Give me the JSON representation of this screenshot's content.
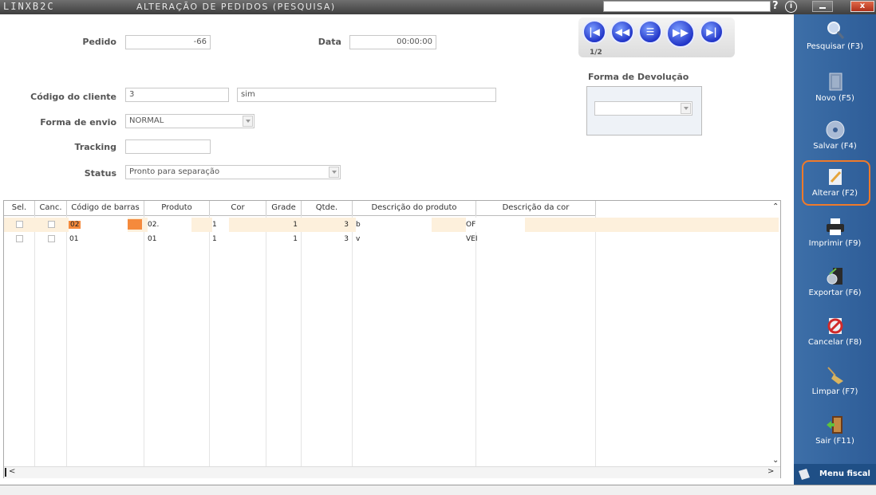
{
  "titlebar": {
    "app_name": "LINXB2C",
    "window_title": "ALTERAÇÃO DE PEDIDOS (PESQUISA)",
    "help": "?",
    "info": "i",
    "close": "x"
  },
  "form": {
    "pedido_label": "Pedido",
    "pedido_value": "-66",
    "data_label": "Data",
    "data_value": "00:00:00",
    "codigo_cliente_label": "Código do cliente",
    "codigo_cliente_value": "3",
    "cliente_nome_value": "sim",
    "forma_envio_label": "Forma de envio",
    "forma_envio_value": "NORMAL",
    "tracking_label": "Tracking",
    "tracking_value": "",
    "status_label": "Status",
    "status_value": "Pronto para separação",
    "forma_devolucao_label": "Forma de Devolução",
    "forma_devolucao_value": ""
  },
  "navigation": {
    "pager": "1/2"
  },
  "grid": {
    "columns": [
      "Sel.",
      "Canc.",
      "Código de barras",
      "Produto",
      "Cor",
      "Grade",
      "Qtde.",
      "Descrição do produto",
      "Descrição da cor"
    ],
    "rows": [
      {
        "barcode": "02",
        "produto": "02.",
        "cor": "1",
        "grade": "1",
        "qtde": "3",
        "descricao": "b",
        "desc_cor": "OF"
      },
      {
        "barcode": "01",
        "produto": "01",
        "cor": "1",
        "grade": "1",
        "qtde": "3",
        "descricao": "v",
        "desc_cor": "VEI"
      }
    ]
  },
  "sidebar": {
    "items": [
      {
        "label": "Pesquisar (F3)",
        "icon": "magnifier-icon"
      },
      {
        "label": "Novo (F5)",
        "icon": "new-document-icon"
      },
      {
        "label": "Salvar (F4)",
        "icon": "disc-icon"
      },
      {
        "label": "Alterar (F2)",
        "icon": "edit-pencil-icon"
      },
      {
        "label": "Imprimir (F9)",
        "icon": "printer-icon"
      },
      {
        "label": "Exportar (F6)",
        "icon": "export-icon"
      },
      {
        "label": "Cancelar (F8)",
        "icon": "cancel-icon"
      },
      {
        "label": "Limpar (F7)",
        "icon": "broom-icon"
      },
      {
        "label": "Sair (F11)",
        "icon": "exit-door-icon"
      }
    ],
    "menu_fiscal": "Menu fiscal",
    "active_highlight_color": "#f07a2a"
  }
}
